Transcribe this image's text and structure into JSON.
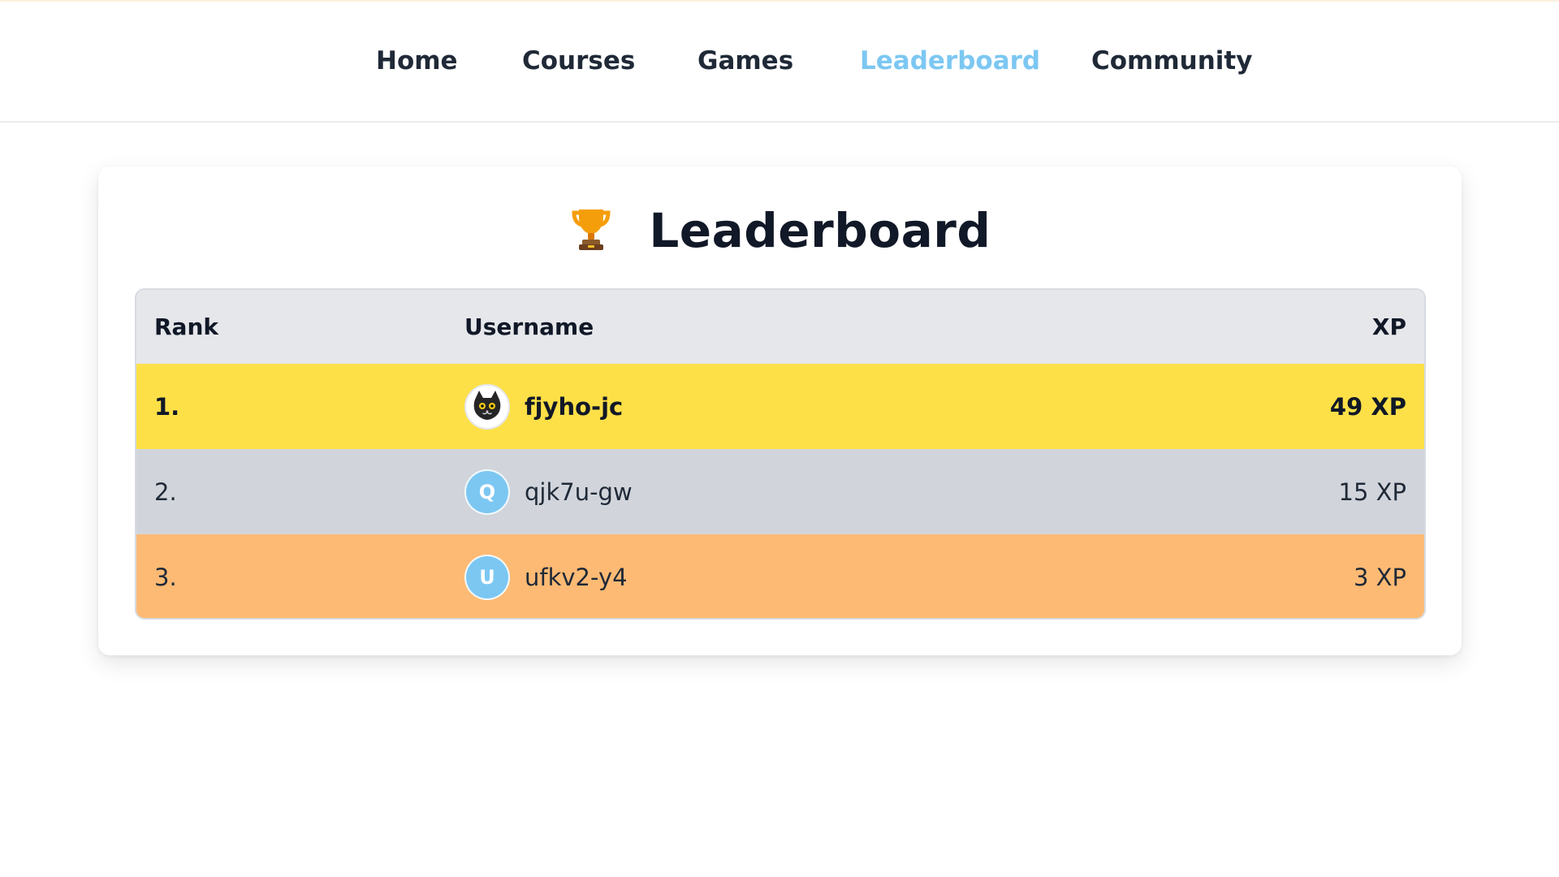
{
  "nav": {
    "items": [
      "Home",
      "Courses",
      "Games",
      "Leaderboard",
      "Community"
    ],
    "active": "Leaderboard"
  },
  "page": {
    "title": "Leaderboard",
    "title_icon": "trophy-icon"
  },
  "leaderboard": {
    "headers": {
      "rank": "Rank",
      "username": "Username",
      "xp": "XP"
    },
    "rows": [
      {
        "rank": "1.",
        "username": "fjyho-jc",
        "xp": "49 XP",
        "avatar_type": "cat-icon",
        "row_color": "#fde047"
      },
      {
        "rank": "2.",
        "username": "qjk7u-gw",
        "xp": "15 XP",
        "avatar_initial": "Q",
        "row_color": "#d1d5db",
        "avatar_color": "#7cc7f2"
      },
      {
        "rank": "3.",
        "username": "ufkv2-y4",
        "xp": "3 XP",
        "avatar_initial": "U",
        "row_color": "#fdba74",
        "avatar_color": "#7cc7f2"
      }
    ]
  },
  "colors": {
    "nav_active": "#7cc7f2",
    "header_bg": "#e5e7eb"
  }
}
